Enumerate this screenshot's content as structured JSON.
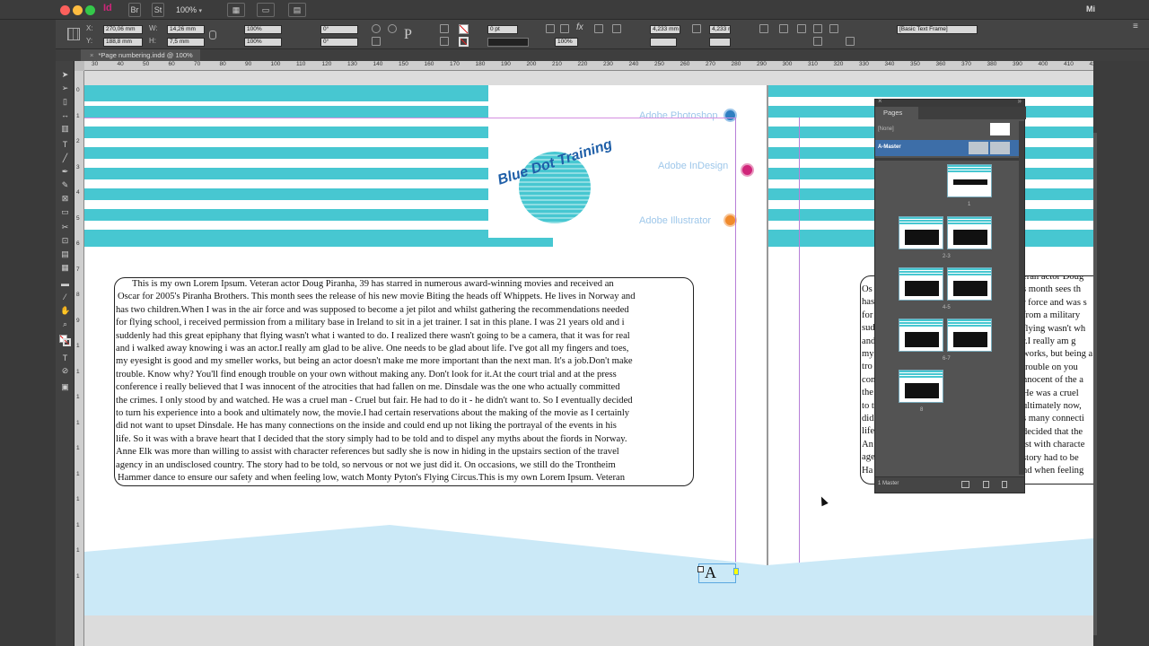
{
  "menubar": {
    "app_icon": "Id",
    "bridge_btn": "Br",
    "stock_btn": "St",
    "zoom": "100%",
    "right_text": "Mi"
  },
  "control": {
    "x": "270,06 mm",
    "y": "188,8 mm",
    "w": "14,26 mm",
    "h": "7,5 mm",
    "x_label": "X:",
    "y_label": "Y:",
    "w_label": "W:",
    "h_label": "H:",
    "scale_x": "100%",
    "scale_y": "100%",
    "rotate": "0°",
    "shear": "0°",
    "stroke_weight": "0 pt",
    "opacity": "100%",
    "gutter": "4,233 mm",
    "gutter2": "4,233 mm",
    "style": "[Basic Text Frame]"
  },
  "tab": {
    "title": "*Page numbering.indd @ 100%",
    "close": "×"
  },
  "ruler": {
    "h_ticks": [
      "30",
      "40",
      "50",
      "60",
      "70",
      "80",
      "90",
      "100",
      "110",
      "120",
      "130",
      "140",
      "150",
      "160",
      "170",
      "180",
      "190",
      "200",
      "210",
      "220",
      "230",
      "240",
      "250",
      "260",
      "270",
      "280",
      "290",
      "300",
      "310",
      "320",
      "330",
      "340",
      "350",
      "360",
      "370",
      "380",
      "390",
      "400",
      "410",
      "420"
    ],
    "v_ticks": [
      "0",
      "1",
      "2",
      "3",
      "4",
      "5",
      "6",
      "7",
      "8",
      "9",
      "1",
      "1",
      "1",
      "1",
      "1",
      "1",
      "1",
      "1",
      "1",
      "1"
    ]
  },
  "page": {
    "menu_items": [
      "Adobe Photoshop",
      "Adobe InDesign",
      "Adobe Illustrator"
    ],
    "logo_text": "Blue Dot Training",
    "body_lines": [
      "This is my own Lorem Ipsum. Veteran actor Doug Piranha, 39 has starred in numerous award-winning movies and received an",
      "Oscar for 2005's Piranha Brothers. This month sees the release of his new movie Biting the heads off Whippets. He lives in Norway and",
      "has two children.When I was in the air force and was supposed to become a jet pilot and whilst gathering the recommendations needed",
      "for flying school, i received permission from a military base in Ireland to sit in a jet trainer. I sat in this plane. I was 21 years old and i",
      "suddenly had this great epiphany that flying wasn't what i wanted to do. I realized there wasn't going to be a camera, that it was for real",
      "and i walked away knowing i was an actor.I really am glad to be alive. One needs to be glad about life. I've got all my fingers and toes,",
      "my eyesight is good and my smeller works, but being an actor doesn't make me more important than the next man. It's a job.Don't make",
      "trouble. Know why? You'll find enough trouble on your own without making any. Don't look for it.At the court trial and at the press",
      "conference i really believed that I was innocent of the atrocities that had fallen on me. Dinsdale was the one who actually committed",
      "the crimes. I only stood by and watched. He was a cruel man - Cruel but fair. He had to do it - he didn't want to. So I eventually decided",
      "to turn his experience into a book and ultimately now, the movie.I had certain reservations about the making of the movie as I certainly",
      "did not want to upset Dinsdale. He has many connections on the inside and could end up not liking the portrayal of the events in his",
      "life. So it was with a brave heart that I decided that the story simply had to be told and to dispel any myths about the fiords in Norway.",
      "Anne Elk was more than willing to assist with character references but sadly she is now in hiding in the upstairs section of the travel",
      "agency in an undisclosed country. The story had to be told, so nervous or not we just did it. On occasions, we still do the Trontheim",
      "Hammer dance to ensure our safety and when feeling low, watch Monty Pyton's Flying Circus.This is my own Lorem Ipsum. Veteran"
    ],
    "right_lines_left": [
      "Os",
      "has",
      "for",
      "sud",
      "and",
      "my",
      "tro",
      "con",
      "the",
      "to t",
      "did",
      "life",
      "An",
      "age",
      "Ha"
    ],
    "right_lines_right": [
      "eran actor Doug",
      "s month sees th",
      "r force and was s",
      "from a military",
      "flying wasn't wh",
      "r.I really am g",
      "works, but being a",
      "trouble on you",
      "nnocent of the a",
      "He was a cruel",
      "ultimately now,",
      "s many connecti",
      "decided that the",
      "ist with characte",
      "story had to be",
      "nd when feeling"
    ],
    "placeholder_glyph": "A"
  },
  "pages_panel": {
    "title": "Pages",
    "none_label": "[None]",
    "master_label": "A-Master",
    "spread_labels": [
      "1",
      "2-3",
      "4-5",
      "6-7",
      "8"
    ],
    "footer_text": "1 Master",
    "close": "×",
    "collapse": "»",
    "menu": "≡"
  },
  "colors": {
    "stripe": "#47c7d1",
    "wave": "#cbe9f7",
    "accent_photoshop": "#2f7fc1",
    "accent_indesign": "#d0257a",
    "accent_illustrator": "#f08a2c"
  }
}
